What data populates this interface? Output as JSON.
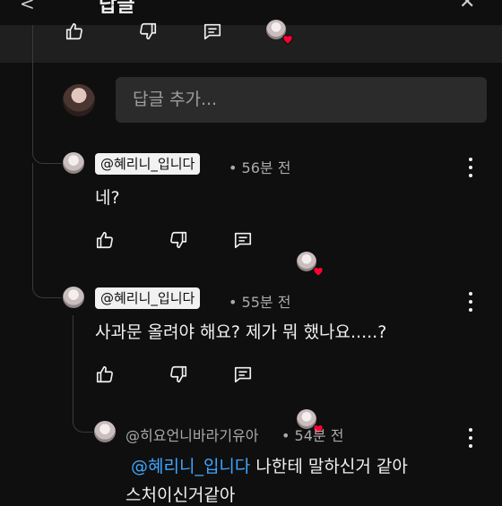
{
  "header": {
    "back_glyph": "<",
    "title": "답글",
    "close_glyph": "✕"
  },
  "reply_box": {
    "placeholder": "답글 추가..."
  },
  "comments": [
    {
      "author": "@혜리니_입니다",
      "time": "• 56분 전",
      "text": "네?"
    },
    {
      "author": "@혜리니_입니다",
      "time": "• 55분 전",
      "text": "사과문 올려야 해요? 제가 뭐 했나요.....?"
    },
    {
      "author": "@히요언니바라기유아",
      "time": "• 54분 전",
      "mention": "@혜리니_입니다",
      "text_rest": " 나한테 말하신거 같아",
      "text_line2": "스처이신거같아"
    }
  ],
  "icons": {
    "like": "thumb-up-icon",
    "dislike": "thumb-down-icon",
    "reply": "reply-icon",
    "creator_heart": "creator-heart-icon",
    "more": "more-vert-icon"
  },
  "colors": {
    "background": "#0f0f0f",
    "mention_link": "#3ea6ff",
    "heart": "#ff0033",
    "input_bg": "#2b2b2b"
  }
}
